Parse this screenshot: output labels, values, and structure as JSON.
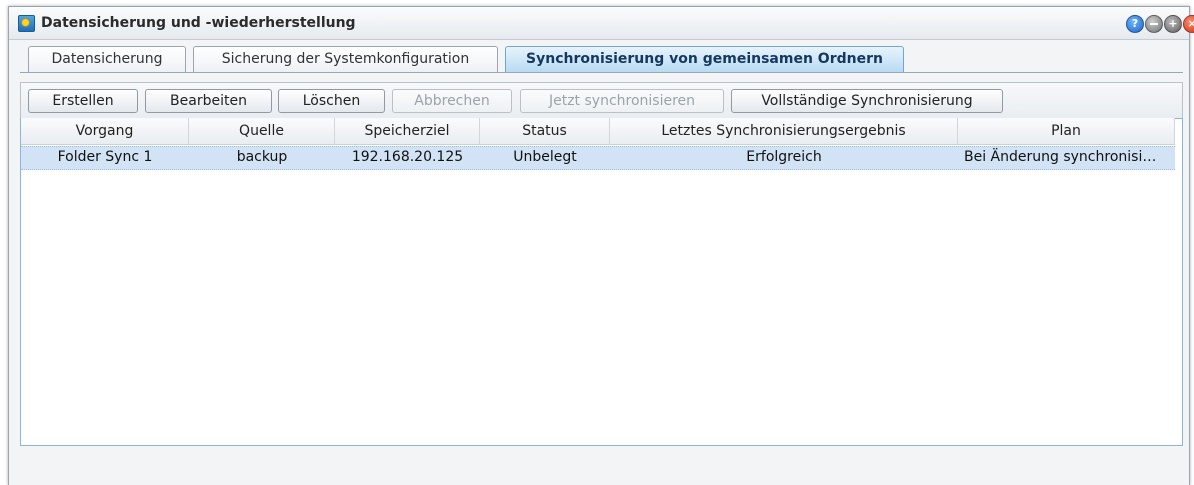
{
  "window": {
    "title": "Datensicherung und -wiederherstellung",
    "controls": [
      "help-icon",
      "minimize-icon",
      "maximize-icon",
      "close-icon"
    ]
  },
  "tabs": [
    {
      "label": "Datensicherung",
      "active": false
    },
    {
      "label": "Sicherung der Systemkonfiguration",
      "active": false
    },
    {
      "label": "Synchronisierung von gemeinsamen Ordnern",
      "active": true
    }
  ],
  "toolbar": {
    "create": "Erstellen",
    "edit": "Bearbeiten",
    "delete": "Löschen",
    "cancel": "Abbrechen",
    "sync_now": "Jetzt synchronisieren",
    "full_sync": "Vollständige Synchronisierung"
  },
  "table": {
    "columns": [
      "Vorgang",
      "Quelle",
      "Speicherziel",
      "Status",
      "Letztes Synchronisierungsergebnis",
      "Plan"
    ],
    "rows": [
      [
        "Folder Sync 1",
        "backup",
        "192.168.20.125",
        "Unbelegt",
        "Erfolgreich",
        "Bei Änderung synchronisi…"
      ]
    ]
  },
  "colors": {
    "active_tab": "#b8dbf4",
    "selected_row": "#d2e3f5",
    "close": "#d0341a",
    "help": "#1e66c8"
  }
}
